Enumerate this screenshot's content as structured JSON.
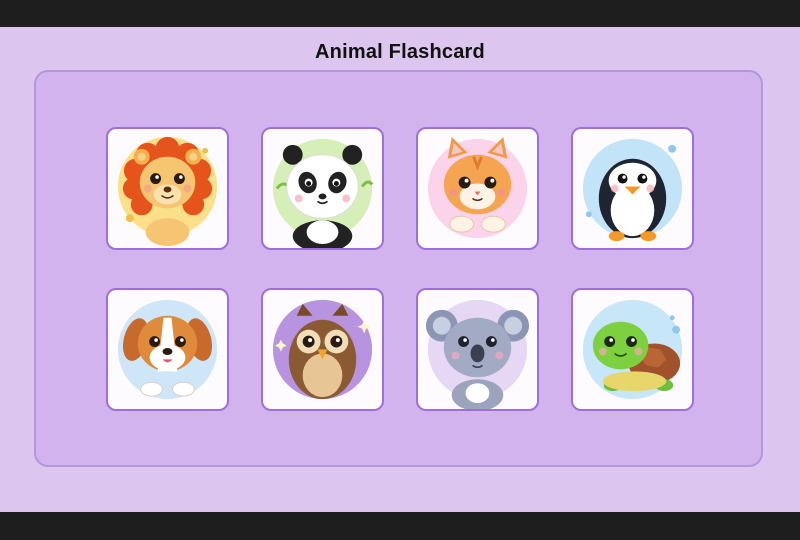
{
  "app": {
    "title": "Animal Flashcard"
  },
  "cards": [
    {
      "animal": "lion",
      "icon": "lion-icon",
      "bg": "#fbe089"
    },
    {
      "animal": "panda",
      "icon": "panda-icon",
      "bg": "#d6efb8"
    },
    {
      "animal": "cat",
      "icon": "cat-icon",
      "bg": "#fbd3ea"
    },
    {
      "animal": "penguin",
      "icon": "penguin-icon",
      "bg": "#c3e4f8"
    },
    {
      "animal": "dog",
      "icon": "dog-icon",
      "bg": "#cfe6f8"
    },
    {
      "animal": "owl",
      "icon": "owl-icon",
      "bg": "#b793e0"
    },
    {
      "animal": "koala",
      "icon": "koala-icon",
      "bg": "#e6d7f4"
    },
    {
      "animal": "turtle",
      "icon": "turtle-icon",
      "bg": "#c7e6f8"
    }
  ]
}
